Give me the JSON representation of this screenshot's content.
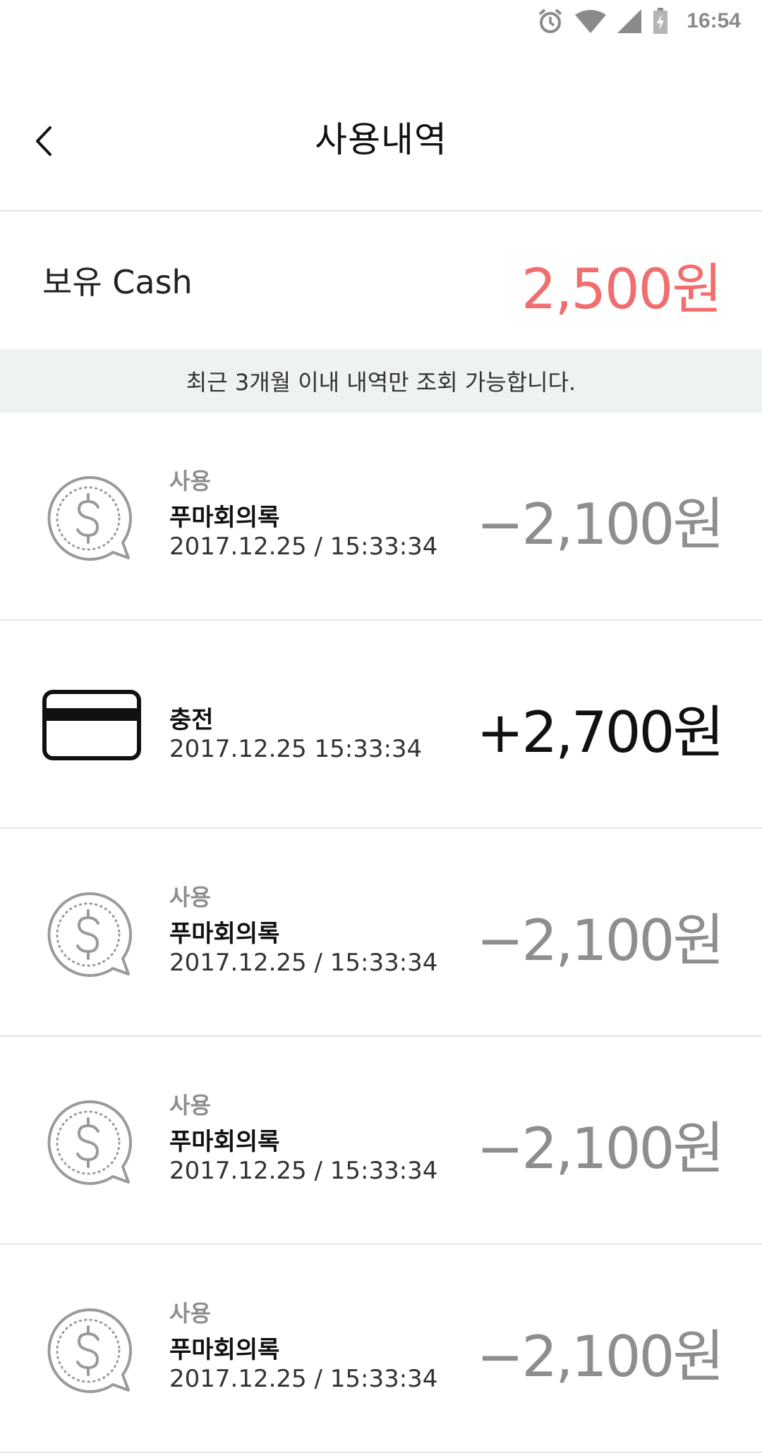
{
  "status_bar": {
    "time": "16:54",
    "icons": [
      "alarm-icon",
      "wifi-icon",
      "signal-icon",
      "battery-icon"
    ]
  },
  "header": {
    "back_icon": "chevron-left-icon",
    "title": "사용내역"
  },
  "balance": {
    "label": "보유 Cash",
    "amount": "2,500원",
    "amount_color": "#f26d6d"
  },
  "notice": "최근 3개월 이내 내역만 조회 가능합니다.",
  "transactions": [
    {
      "kind": "use",
      "icon": "dollar-chat-icon",
      "type": "사용",
      "description": "푸마회의록",
      "datetime": "2017.12.25 / 15:33:34",
      "amount": "−2,100원"
    },
    {
      "kind": "charge",
      "icon": "credit-card-icon",
      "type": "충전",
      "datetime": "2017.12.25 15:33:34",
      "amount": "+2,700원"
    },
    {
      "kind": "use",
      "icon": "dollar-chat-icon",
      "type": "사용",
      "description": "푸마회의록",
      "datetime": "2017.12.25 / 15:33:34",
      "amount": "−2,100원"
    },
    {
      "kind": "use",
      "icon": "dollar-chat-icon",
      "type": "사용",
      "description": "푸마회의록",
      "datetime": "2017.12.25 / 15:33:34",
      "amount": "−2,100원"
    },
    {
      "kind": "use",
      "icon": "dollar-chat-icon",
      "type": "사용",
      "description": "푸마회의록",
      "datetime": "2017.12.25 / 15:33:34",
      "amount": "−2,100원"
    }
  ]
}
